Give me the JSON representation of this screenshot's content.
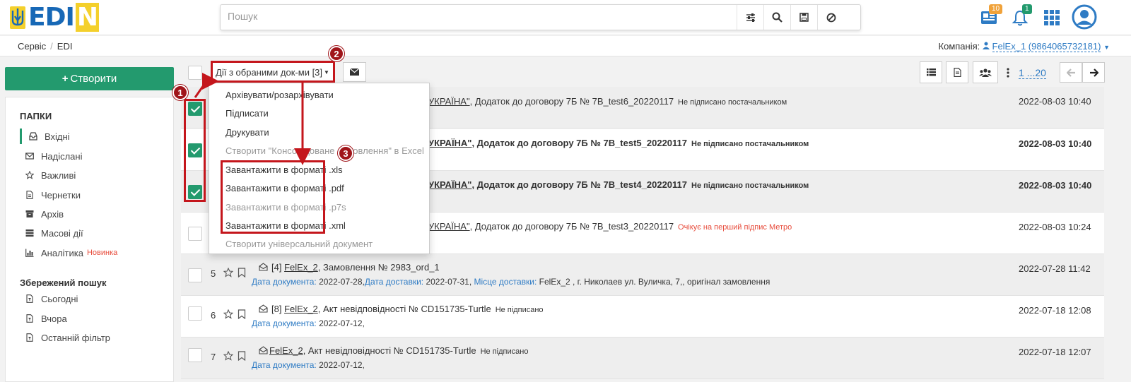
{
  "logo": {
    "text": "EDI",
    "last": "N"
  },
  "search": {
    "placeholder": "Пошук"
  },
  "header": {
    "reports_badge": "10",
    "notify_badge": "1"
  },
  "breadcrumb": {
    "item1": "Сервіс",
    "sep": "/",
    "item2": "EDI"
  },
  "company": {
    "label": "Компанія:",
    "value": "FelEx_1 (9864065732181)"
  },
  "sidebar": {
    "create_label": "Створити",
    "folders_title": "ПАПКИ",
    "folders": [
      {
        "label": "Вхідні"
      },
      {
        "label": "Надіслані"
      },
      {
        "label": "Важливі"
      },
      {
        "label": "Чернетки"
      },
      {
        "label": "Архів"
      },
      {
        "label": "Масові дії"
      },
      {
        "label": "Аналітика",
        "badge": "Новинка"
      }
    ],
    "saved_title": "Збережений пошук",
    "saved": [
      {
        "label": "Сьогодні"
      },
      {
        "label": "Вчора"
      },
      {
        "label": "Останній фільтр"
      }
    ]
  },
  "toolbar": {
    "actions_label": "Дії з обраними док-ми [3]",
    "pager": "1 ...20"
  },
  "dropdown": {
    "items": [
      {
        "label": "Архівувати/розархівувати"
      },
      {
        "label": "Підписати"
      },
      {
        "label": "Друкувати"
      },
      {
        "label": "Створити \"Консолідоване замовлення\" в Excel"
      },
      {
        "label": "Завантажити в форматі .xls"
      },
      {
        "label": "Завантажити в форматі .pdf"
      },
      {
        "label": "Завантажити в форматі .p7s"
      },
      {
        "label": "Завантажити в форматі .xml"
      },
      {
        "label": "Створити універсальний документ"
      }
    ]
  },
  "annotations": {
    "m1": "1",
    "m2": "2",
    "m3": "3"
  },
  "documents": [
    {
      "pre": "УКРАЇНА\"",
      "text": ", Додаток до договору 7Б № 7В_test6_20220117",
      "status": "Не підписано постачальником",
      "date": "2022-08-03 10:40"
    },
    {
      "pre": "УКРАЇНА\"",
      "text": ", Додаток до договору 7Б № 7В_test5_20220117",
      "status": "Не підписано постачальником",
      "date": "2022-08-03 10:40"
    },
    {
      "pre": "УКРАЇНА\"",
      "text": ", Додаток до договору 7Б № 7В_test4_20220117",
      "status": "Не підписано постачальником",
      "date": "2022-08-03 10:40"
    },
    {
      "pre": "УКРАЇНА\"",
      "text": ", Додаток до договору 7Б № 7В_test3_20220117",
      "status": "Очікує на перший підпис Метро",
      "date": "2022-08-03 10:24"
    },
    {
      "num": "5",
      "prefix": "[4]",
      "company": "FelEx_2",
      "text": ", Замовлення № 2983_ord_1",
      "date": "2022-07-28 11:42",
      "meta": {
        "k1": "Дата документа:",
        "v1": "2022-07-28,",
        "k2": "Дата доставки:",
        "v2": "2022-07-31,",
        "k3": "Місце доставки:",
        "v3": "FelEx_2 , г. Николаев ул. Вуличка, 7,, оригінал замовлення"
      }
    },
    {
      "num": "6",
      "prefix": "[8]",
      "company": "FelEx_2",
      "text": ", Акт невідповідності № CD151735-Turtle",
      "status": "Не підписано",
      "date": "2022-07-18 12:08",
      "meta": {
        "k1": "Дата документа:",
        "v1": "2022-07-12,"
      }
    },
    {
      "num": "7",
      "prefix": "",
      "company": "FelEx_2",
      "text": ", Акт невідповідності № CD151735-Turtle",
      "status": "Не підписано",
      "date": "2022-07-18 12:07",
      "meta": {
        "k1": "Дата документа:",
        "v1": "2022-07-12,"
      }
    }
  ]
}
